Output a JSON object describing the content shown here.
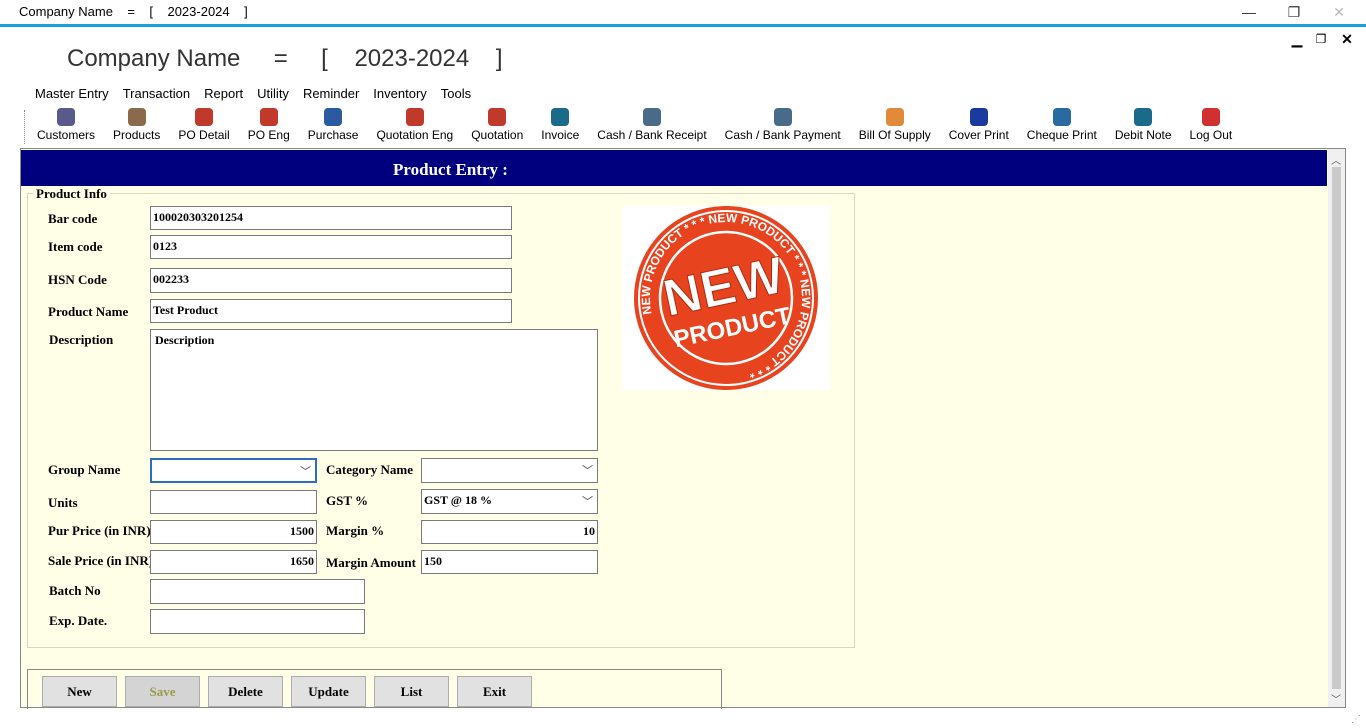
{
  "window": {
    "title": "Company Name    =    [    2023-2024    ]",
    "minimize": "—",
    "restore": "❐",
    "close": "✕"
  },
  "mdi": {
    "minimize": "▁",
    "restore": "❐",
    "close": "✕"
  },
  "app_header": "Company Name     =     [    2023-2024    ]",
  "menu": [
    "Master Entry",
    "Transaction",
    "Report",
    "Utility",
    "Reminder",
    "Inventory",
    "Tools"
  ],
  "toolbar": [
    {
      "label": "Customers",
      "icon": "customers-icon",
      "color": "#5a5a8a"
    },
    {
      "label": "Products",
      "icon": "products-icon",
      "color": "#8a6a4a"
    },
    {
      "label": "PO Detail",
      "icon": "po-detail-icon",
      "color": "#c0392b"
    },
    {
      "label": "PO Eng",
      "icon": "po-eng-icon",
      "color": "#c0392b"
    },
    {
      "label": "Purchase",
      "icon": "cart-icon",
      "color": "#2c5aa0"
    },
    {
      "label": "Quotation Eng",
      "icon": "quotation-eng-icon",
      "color": "#c0392b"
    },
    {
      "label": "Quotation",
      "icon": "quotation-icon",
      "color": "#c0392b"
    },
    {
      "label": "Invoice",
      "icon": "invoice-icon",
      "color": "#1a6a8a"
    },
    {
      "label": "Cash / Bank Receipt",
      "icon": "receipt-icon",
      "color": "#4a6a8a"
    },
    {
      "label": "Cash / Bank Payment",
      "icon": "payment-icon",
      "color": "#4a6a8a"
    },
    {
      "label": "Bill Of Supply",
      "icon": "bill-of-supply-icon",
      "color": "#e08a3a"
    },
    {
      "label": "Cover Print",
      "icon": "cover-print-icon",
      "color": "#1a3aa0"
    },
    {
      "label": "Cheque Print",
      "icon": "cheque-print-icon",
      "color": "#2a6aa0"
    },
    {
      "label": "Debit Note",
      "icon": "debit-note-icon",
      "color": "#1a6a8a"
    },
    {
      "label": "Log Out",
      "icon": "power-icon",
      "color": "#d03030"
    }
  ],
  "form": {
    "header": "Product Entry :",
    "group_title": "Product Info",
    "labels": {
      "bar_code": "Bar code",
      "item_code": "Item code",
      "hsn_code": "HSN Code",
      "product_name": "Product Name",
      "description": "Description",
      "group_name": "Group Name",
      "category_name": "Category Name",
      "units": "Units",
      "gst": "GST %",
      "pur_price": "Pur Price (in INR)",
      "margin_pct": "Margin %",
      "sale_price": "Sale Price (in INR)",
      "margin_amount": "Margin Amount",
      "batch_no": "Batch No",
      "exp_date": "Exp. Date."
    },
    "values": {
      "bar_code": "100020303201254",
      "item_code": "0123",
      "hsn_code": "002233",
      "product_name": "Test Product",
      "description": "Description",
      "group_name": "",
      "category_name": "",
      "units": "",
      "gst": "GST @ 18 %",
      "pur_price": "1500",
      "margin_pct": "10",
      "sale_price": "1650",
      "margin_amount": "150",
      "batch_no": "",
      "exp_date": ""
    },
    "stamp": {
      "ring_text": "NEW PRODUCT * * * NEW PRODUCT * * * NEW PRODUCT * * *",
      "line1": "NEW",
      "line2": "PRODUCT",
      "color": "#e8431f"
    }
  },
  "buttons": {
    "new": "New",
    "save": "Save",
    "delete": "Delete",
    "update": "Update",
    "list": "List",
    "exit": "Exit"
  },
  "colors": {
    "accent": "#1aa0d8",
    "header_bg": "#00007f",
    "form_bg": "#ffffe8"
  }
}
